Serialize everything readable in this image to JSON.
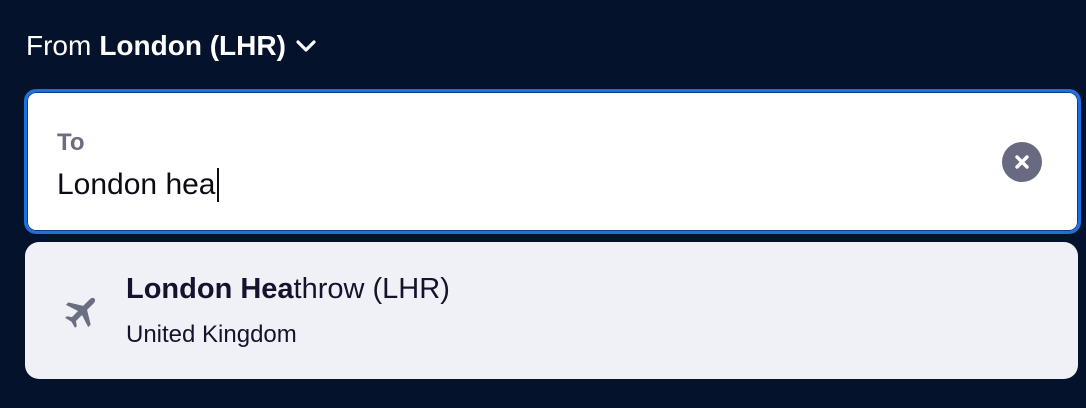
{
  "from": {
    "prefix": "From",
    "value": "London (LHR)",
    "chevron_icon": "chevron-down-icon"
  },
  "to": {
    "label": "To",
    "value": "London hea",
    "clear_icon": "close-icon"
  },
  "suggestions": [
    {
      "icon": "plane-icon",
      "title_match": "London Hea",
      "title_rest": "throw (LHR)",
      "subtitle": "United Kingdom"
    }
  ],
  "colors": {
    "background": "#05122b",
    "focus_border": "#1f6fe0",
    "suggestion_bg": "#f0f1f6",
    "muted_text": "#6b6d80"
  }
}
